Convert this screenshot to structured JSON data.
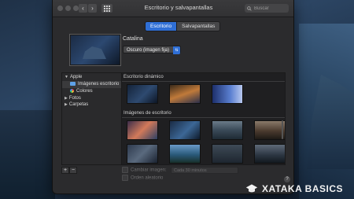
{
  "window": {
    "title": "Escritorio y salvapantallas",
    "search_placeholder": "Buscar"
  },
  "tabs": [
    {
      "label": "Escritorio",
      "active": true
    },
    {
      "label": "Salvapantallas",
      "active": false
    }
  ],
  "current": {
    "name": "Catalina",
    "appearance": "Oscuro (imagen fija)"
  },
  "sidebar": {
    "groups": [
      {
        "label": "Apple",
        "expanded": true
      },
      {
        "label": "Imágenes escritorio",
        "selected": true
      },
      {
        "label": "Colores"
      },
      {
        "label": "Fotos",
        "expanded": false
      },
      {
        "label": "Carpetas",
        "expanded": false
      }
    ]
  },
  "gallery": {
    "section_dynamic": "Escritorio dinámico",
    "section_images": "Imágenes de escritorio"
  },
  "footer": {
    "change_image": "Cambiar imagen:",
    "interval": "Cada 30 minutos",
    "random_order": "Orden aleatorio"
  },
  "watermark": "XATAKA BASICS",
  "colors": {
    "accent": "#2f6fd6",
    "window_bg": "#2b2b2d"
  }
}
